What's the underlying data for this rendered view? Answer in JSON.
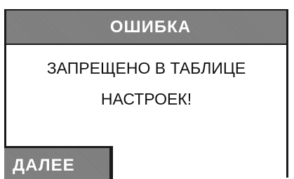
{
  "dialog": {
    "title": "ОШИБКА",
    "message_line1": "ЗАПРЕЩЕНО В ТАБЛИЦЕ",
    "message_line2": "НАСТРОЕК!",
    "next_button_label": "ДАЛЕЕ"
  },
  "colors": {
    "bar_background": "#808080",
    "border": "#1a1a1a",
    "bar_text": "#ffffff",
    "body_background": "#ffffff",
    "body_text": "#111111"
  }
}
